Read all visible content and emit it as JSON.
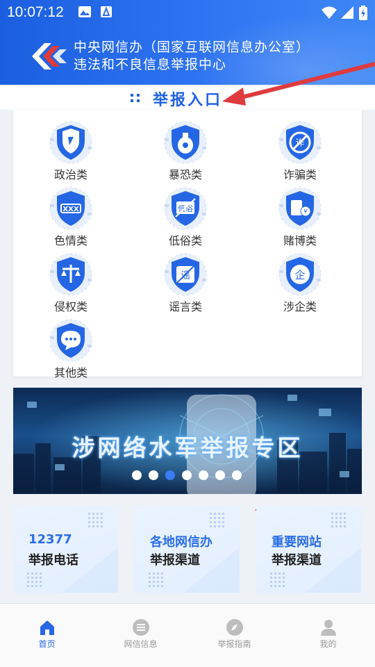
{
  "status_bar": {
    "time": "10:07:12"
  },
  "header": {
    "title_line1": "中央网信办（国家互联网信息办公室）",
    "title_line2": "违法和不良信息举报中心"
  },
  "section": {
    "title": "举报入口"
  },
  "categories": [
    {
      "label": "政治类",
      "icon": "shield-flag-icon"
    },
    {
      "label": "暴恐类",
      "icon": "grenade-icon"
    },
    {
      "label": "诈骗类",
      "icon": "fraud-icon"
    },
    {
      "label": "色情类",
      "icon": "xxx-icon"
    },
    {
      "label": "低俗类",
      "icon": "vulgar-icon"
    },
    {
      "label": "赌博类",
      "icon": "gambling-icon"
    },
    {
      "label": "侵权类",
      "icon": "scales-icon"
    },
    {
      "label": "谣言类",
      "icon": "rumor-icon"
    },
    {
      "label": "涉企类",
      "icon": "enterprise-icon"
    },
    {
      "label": "其他类",
      "icon": "chat-bubble-icon"
    }
  ],
  "banner": {
    "text": "涉网络水军举报专区",
    "carousel_count": 7,
    "carousel_active_index": 2
  },
  "channels": [
    {
      "line1": "12377",
      "line2": "举报电话"
    },
    {
      "line1": "各地网信办",
      "line2": "举报渠道"
    },
    {
      "line1": "重要网站",
      "line2": "举报渠道"
    }
  ],
  "nav": [
    {
      "label": "首页",
      "icon": "home-icon",
      "active": true
    },
    {
      "label": "网信信息",
      "icon": "list-icon",
      "active": false
    },
    {
      "label": "举报指南",
      "icon": "compass-icon",
      "active": false
    },
    {
      "label": "我的",
      "icon": "user-icon",
      "active": false
    }
  ],
  "colors": {
    "primary": "#1f62e5",
    "arrow": "#e03a3e"
  }
}
